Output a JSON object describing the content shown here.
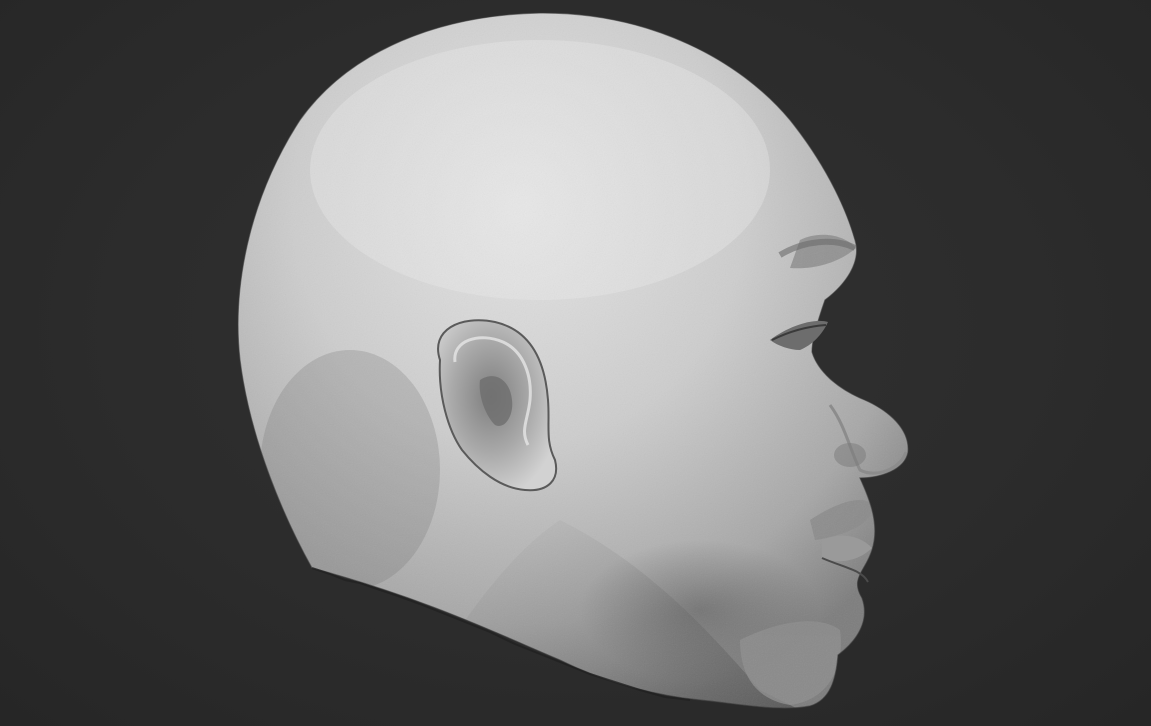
{
  "viewport": {
    "background_color": "#2b2b2b",
    "model": {
      "subject": "sculpted-head-profile",
      "material_color": "#cfcfcf",
      "shadow_color": "#5a5a5a",
      "highlight_color": "#ececec"
    }
  }
}
